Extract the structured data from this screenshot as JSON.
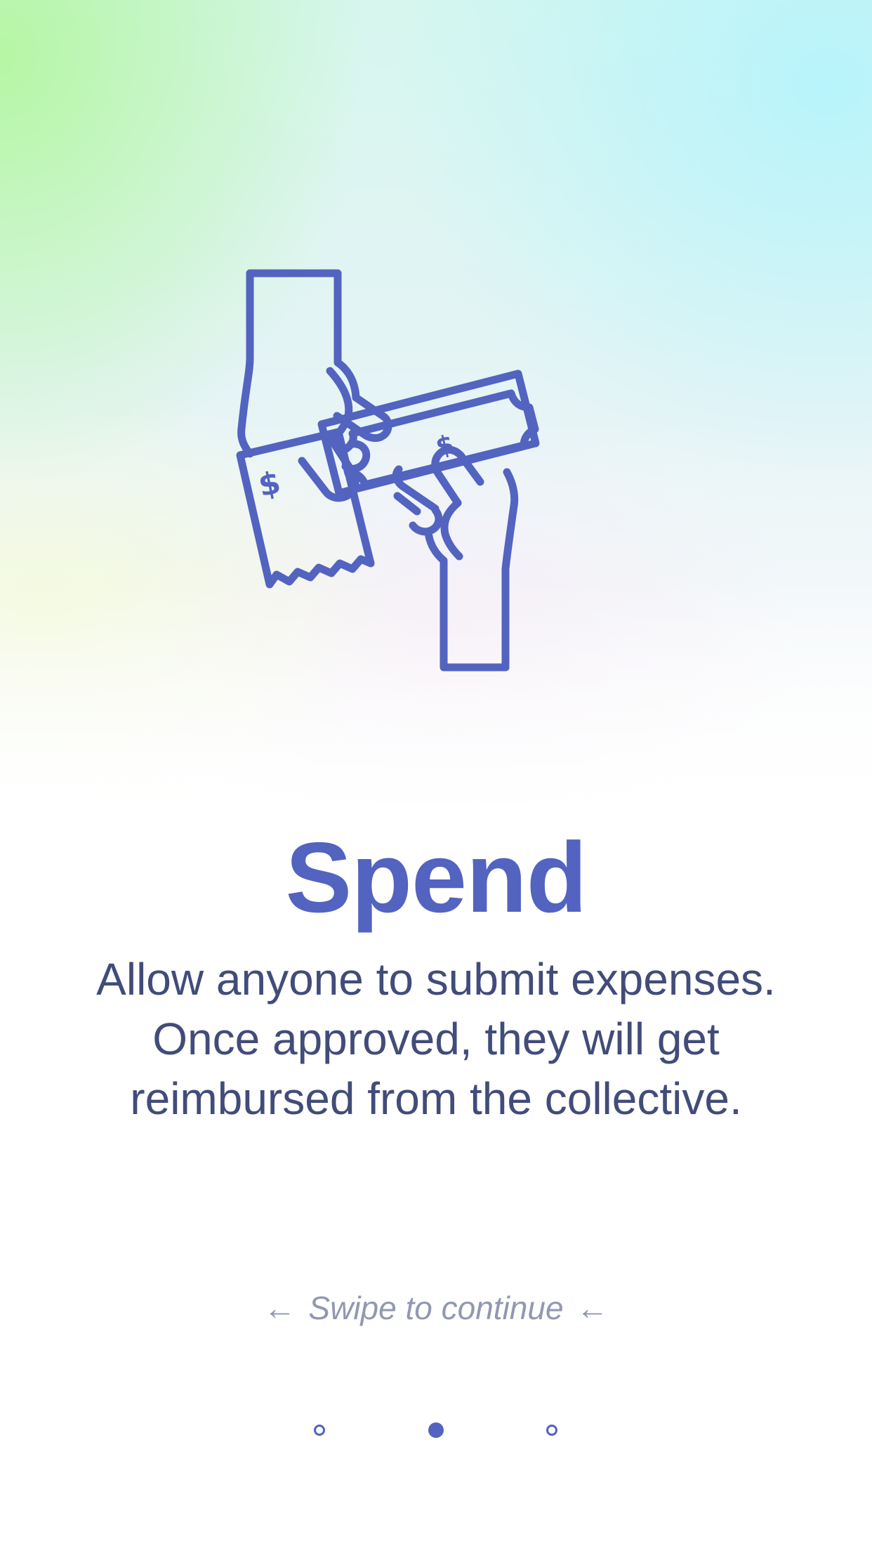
{
  "onboarding": {
    "title": "Spend",
    "description": "Allow anyone to submit expenses. Once approved, they will get reimbursed from the collective.",
    "swipe_hint": "Swipe to continue",
    "swipe_arrow_left": "←",
    "swipe_arrow_right": "←",
    "illustration_icon": "hands-exchanging-money-icon",
    "receipt_symbol": "$",
    "banknote_symbol": "$",
    "pagination": {
      "total": 3,
      "active_index": 1
    }
  },
  "colors": {
    "accent": "#5363c0",
    "text": "#424c7a",
    "hint": "#9198b0"
  }
}
